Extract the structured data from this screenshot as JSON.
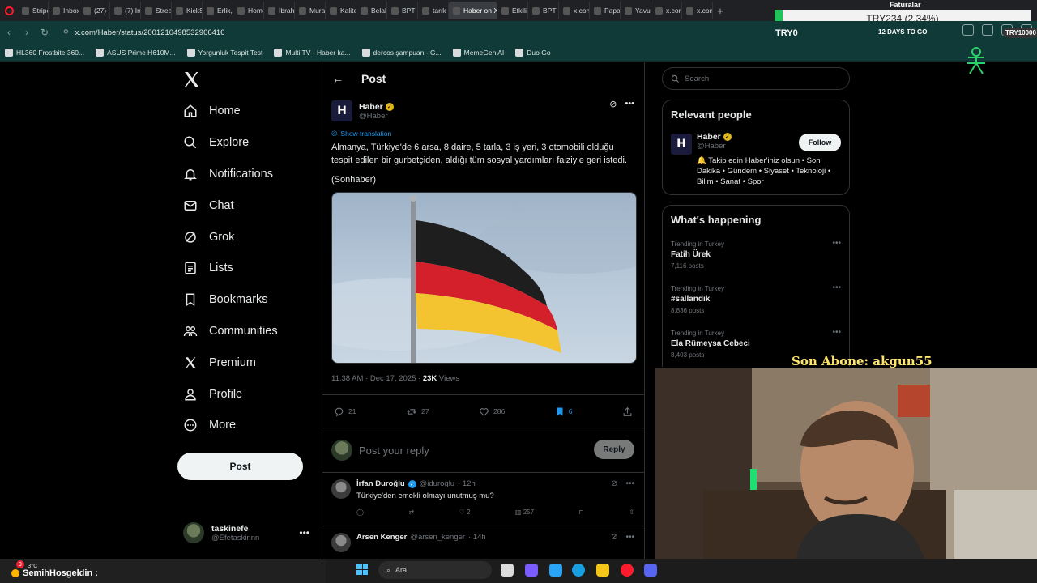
{
  "browser": {
    "tabs": [
      {
        "label": "Stripe"
      },
      {
        "label": "Inbox"
      },
      {
        "label": "(27) D"
      },
      {
        "label": "(7) Ins"
      },
      {
        "label": "Stream"
      },
      {
        "label": "KickS"
      },
      {
        "label": "Erlik, /"
      },
      {
        "label": "Home"
      },
      {
        "label": "İbrahi"
      },
      {
        "label": "Mura"
      },
      {
        "label": "Kalite"
      },
      {
        "label": "Belal"
      },
      {
        "label": "BPT o"
      },
      {
        "label": "tarık"
      },
      {
        "label": "Haber on X",
        "active": true
      },
      {
        "label": "Etkili"
      },
      {
        "label": "BPT o"
      },
      {
        "label": "x.com"
      },
      {
        "label": "Papar"
      },
      {
        "label": "Yavuz"
      },
      {
        "label": "x.com"
      },
      {
        "label": "x.com"
      }
    ],
    "url": "x.com/Haber/status/2001210498532966416",
    "bookmarks": [
      {
        "label": "HL360 Frostbite 360..."
      },
      {
        "label": "ASUS Prime H610M..."
      },
      {
        "label": "Yorgunluk Tespit Test"
      },
      {
        "label": "Multi TV - Haber ka..."
      },
      {
        "label": "dercos şampuan - G..."
      },
      {
        "label": "MemeGen AI"
      },
      {
        "label": "Duo Go"
      }
    ]
  },
  "stream_overlay": {
    "ticker": "TRY234 (2.34%)",
    "faturalar": "Faturalar",
    "try0": "TRY0",
    "days_to_go": "12 DAYS TO GO",
    "try_right": "TRY10000",
    "son_abone": "Son Abone: akgun55",
    "chat_user": "SemihHosgeldin :",
    "notif_count": "9",
    "temp": "3°C"
  },
  "nav": {
    "items": [
      {
        "label": "Home",
        "icon": "home-icon"
      },
      {
        "label": "Explore",
        "icon": "search-icon"
      },
      {
        "label": "Notifications",
        "icon": "bell-icon"
      },
      {
        "label": "Chat",
        "icon": "mail-icon"
      },
      {
        "label": "Grok",
        "icon": "grok-icon"
      },
      {
        "label": "Lists",
        "icon": "list-icon"
      },
      {
        "label": "Bookmarks",
        "icon": "bookmark-icon"
      },
      {
        "label": "Communities",
        "icon": "people-icon"
      },
      {
        "label": "Premium",
        "icon": "x-icon"
      },
      {
        "label": "Profile",
        "icon": "person-icon"
      },
      {
        "label": "More",
        "icon": "more-circle-icon"
      }
    ],
    "post_label": "Post"
  },
  "account": {
    "name": "taskinefe",
    "handle": "@Efetaskinnn"
  },
  "main": {
    "header_title": "Post",
    "tweet": {
      "author_name": "Haber",
      "author_handle": "@Haber",
      "avatar_letter": "H",
      "show_translation": "Show translation",
      "text": "Almanya, Türkiye'de 6 arsa, 8 daire, 5 tarla, 3 iş yeri, 3 otomobili olduğu tespit edilen bir gurbetçiden, aldığı tüm sosyal yardımları faiziyle geri istedi.",
      "source": "(Sonhaber)",
      "time": "11:38 AM · Dec 17, 2025 · ",
      "views_count": "23K",
      "views_label": " Views",
      "replies": "21",
      "reposts": "27",
      "likes": "286",
      "bookmarks": "6"
    },
    "reply_placeholder": "Post your reply",
    "reply_button": "Reply",
    "comments": [
      {
        "name": "İrfan Duroğlu",
        "handle": "@iduroglu",
        "time": "· 12h",
        "text": "Türkiye'den emekli olmayı unutmuş mu?",
        "replies": "",
        "reposts": "",
        "likes": "2",
        "views": "257"
      },
      {
        "name": "Arsen Kenger",
        "handle": "@arsen_kenger",
        "time": "· 14h",
        "text": ""
      }
    ]
  },
  "right": {
    "search_placeholder": "Search",
    "relevant": {
      "title": "Relevant people",
      "name": "Haber",
      "handle": "@Haber",
      "follow": "Follow",
      "bio": "🔔 Takip edin Haber'iniz olsun • Son Dakika • Gündem • Siyaset • Teknoloji • Bilim • Sanat • Spor"
    },
    "happening": {
      "title": "What's happening",
      "trends": [
        {
          "context": "Trending in Turkey",
          "name": "Fatih Ürek",
          "posts": "7,116 posts"
        },
        {
          "context": "Trending in Turkey",
          "name": "#sallandık",
          "posts": "8,836 posts"
        },
        {
          "context": "Trending in Turkey",
          "name": "Ela Rümeysa Cebeci",
          "posts": "8,403 posts"
        }
      ]
    }
  },
  "taskbar": {
    "search": "Ara"
  },
  "colors": {
    "accent": "#1d9bf0",
    "verified": "#e2b719",
    "chrome": "#0f3a37"
  }
}
